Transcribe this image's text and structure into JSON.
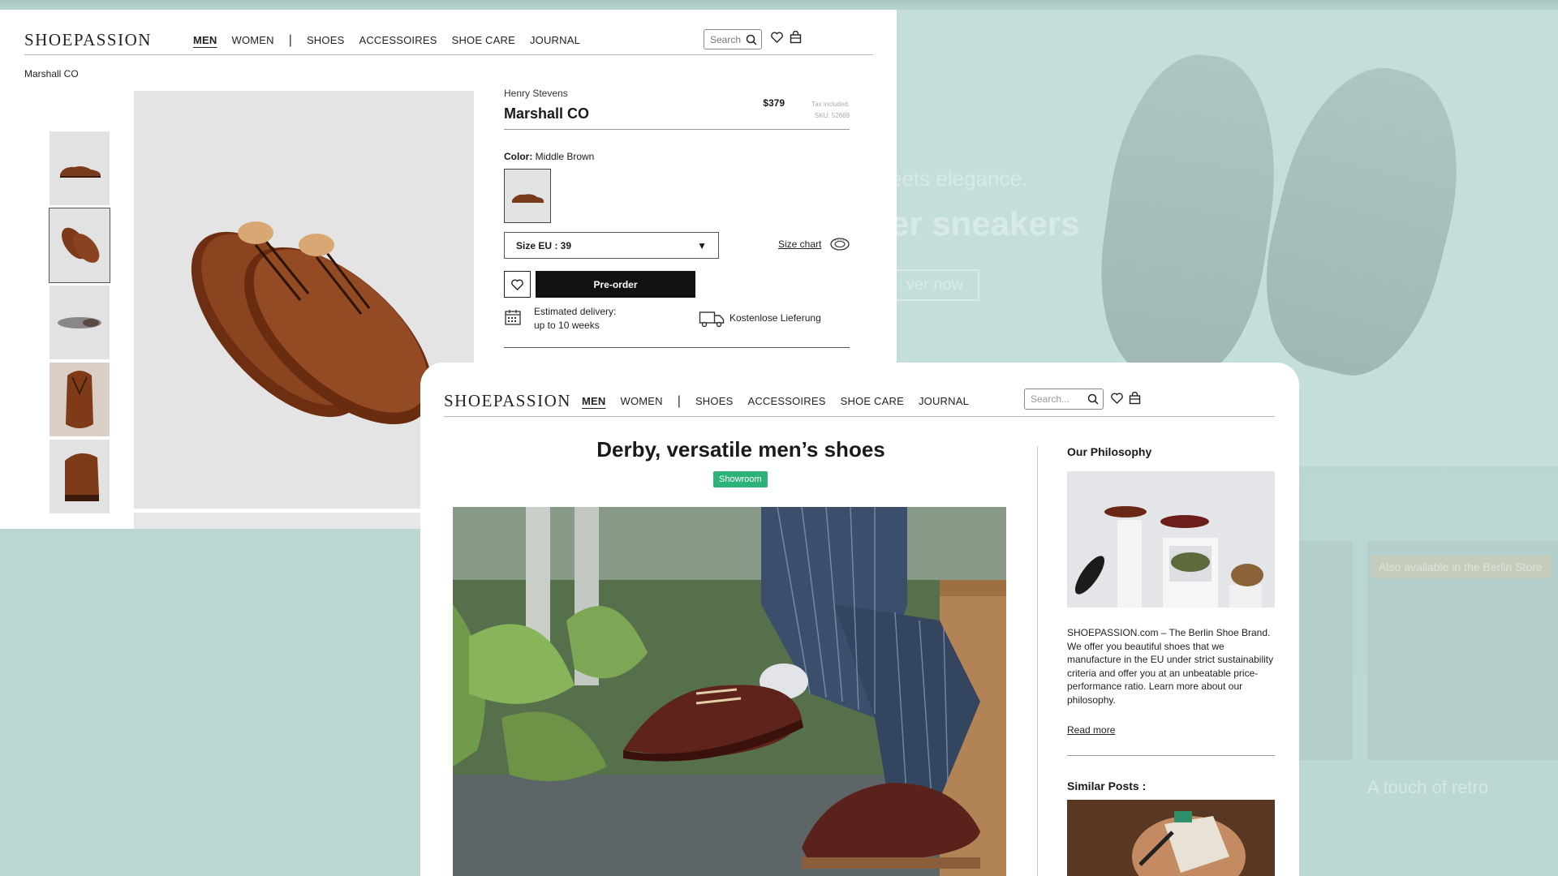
{
  "background": {
    "tagline_small": "eets elegance.",
    "tagline_big": "er sneakers",
    "cta": "ver now",
    "lower_badge": "Also available in the Berlin Store",
    "lower_text": "A touch of retro"
  },
  "product_page": {
    "logo": "SHOEPASSION",
    "nav": {
      "men": "MEN",
      "women": "WOMEN",
      "sep": "|",
      "shoes": "SHOES",
      "accessoires": "ACCESSOIRES",
      "shoe_care": "SHOE CARE",
      "journal": "JOURNAL"
    },
    "search_placeholder": "Search",
    "breadcrumb": "Marshall CO",
    "brand": "Henry Stevens",
    "name": "Marshall CO",
    "price": "$379",
    "tax_note": "Tax included.",
    "sku": "SKU: 52669",
    "color_label": "Color:",
    "color_value": " Middle Brown",
    "size_value": "Size EU : 39",
    "size_chart": "Size chart",
    "preorder": "Pre-order",
    "delivery_line1": "Estimated delivery:",
    "delivery_line2": "up to 10 weeks",
    "free_shipping": "Kostenlose Lieferung"
  },
  "journal_page": {
    "logo": "SHOEPASSION",
    "nav": {
      "men": "MEN",
      "women": "WOMEN",
      "sep": "|",
      "shoes": "SHOES",
      "accessoires": "ACCESSOIRES",
      "shoe_care": "SHOE CARE",
      "journal": "JOURNAL"
    },
    "search_placeholder": "Search...",
    "title": "Derby, versatile men’s shoes",
    "badge": "Showroom",
    "sidebar": {
      "philosophy_heading": "Our Philosophy",
      "philosophy_text": "SHOEPASSION.com – The Berlin Shoe Brand. We offer you beautiful shoes that we manufacture in the EU under strict sustainability criteria and offer you at an unbeatable price-performance ratio. Learn more about our philosophy.",
      "read_more": "Read more",
      "similar_heading": "Similar Posts :"
    }
  },
  "colors": {
    "accent_green": "#2db37a",
    "background_mint": "#bcd8d4",
    "button_black": "#111111"
  },
  "icons": [
    "search-icon",
    "heart-icon",
    "bag-icon",
    "calendar-icon",
    "truck-icon",
    "measuring-tape-icon",
    "caret-down-icon"
  ]
}
